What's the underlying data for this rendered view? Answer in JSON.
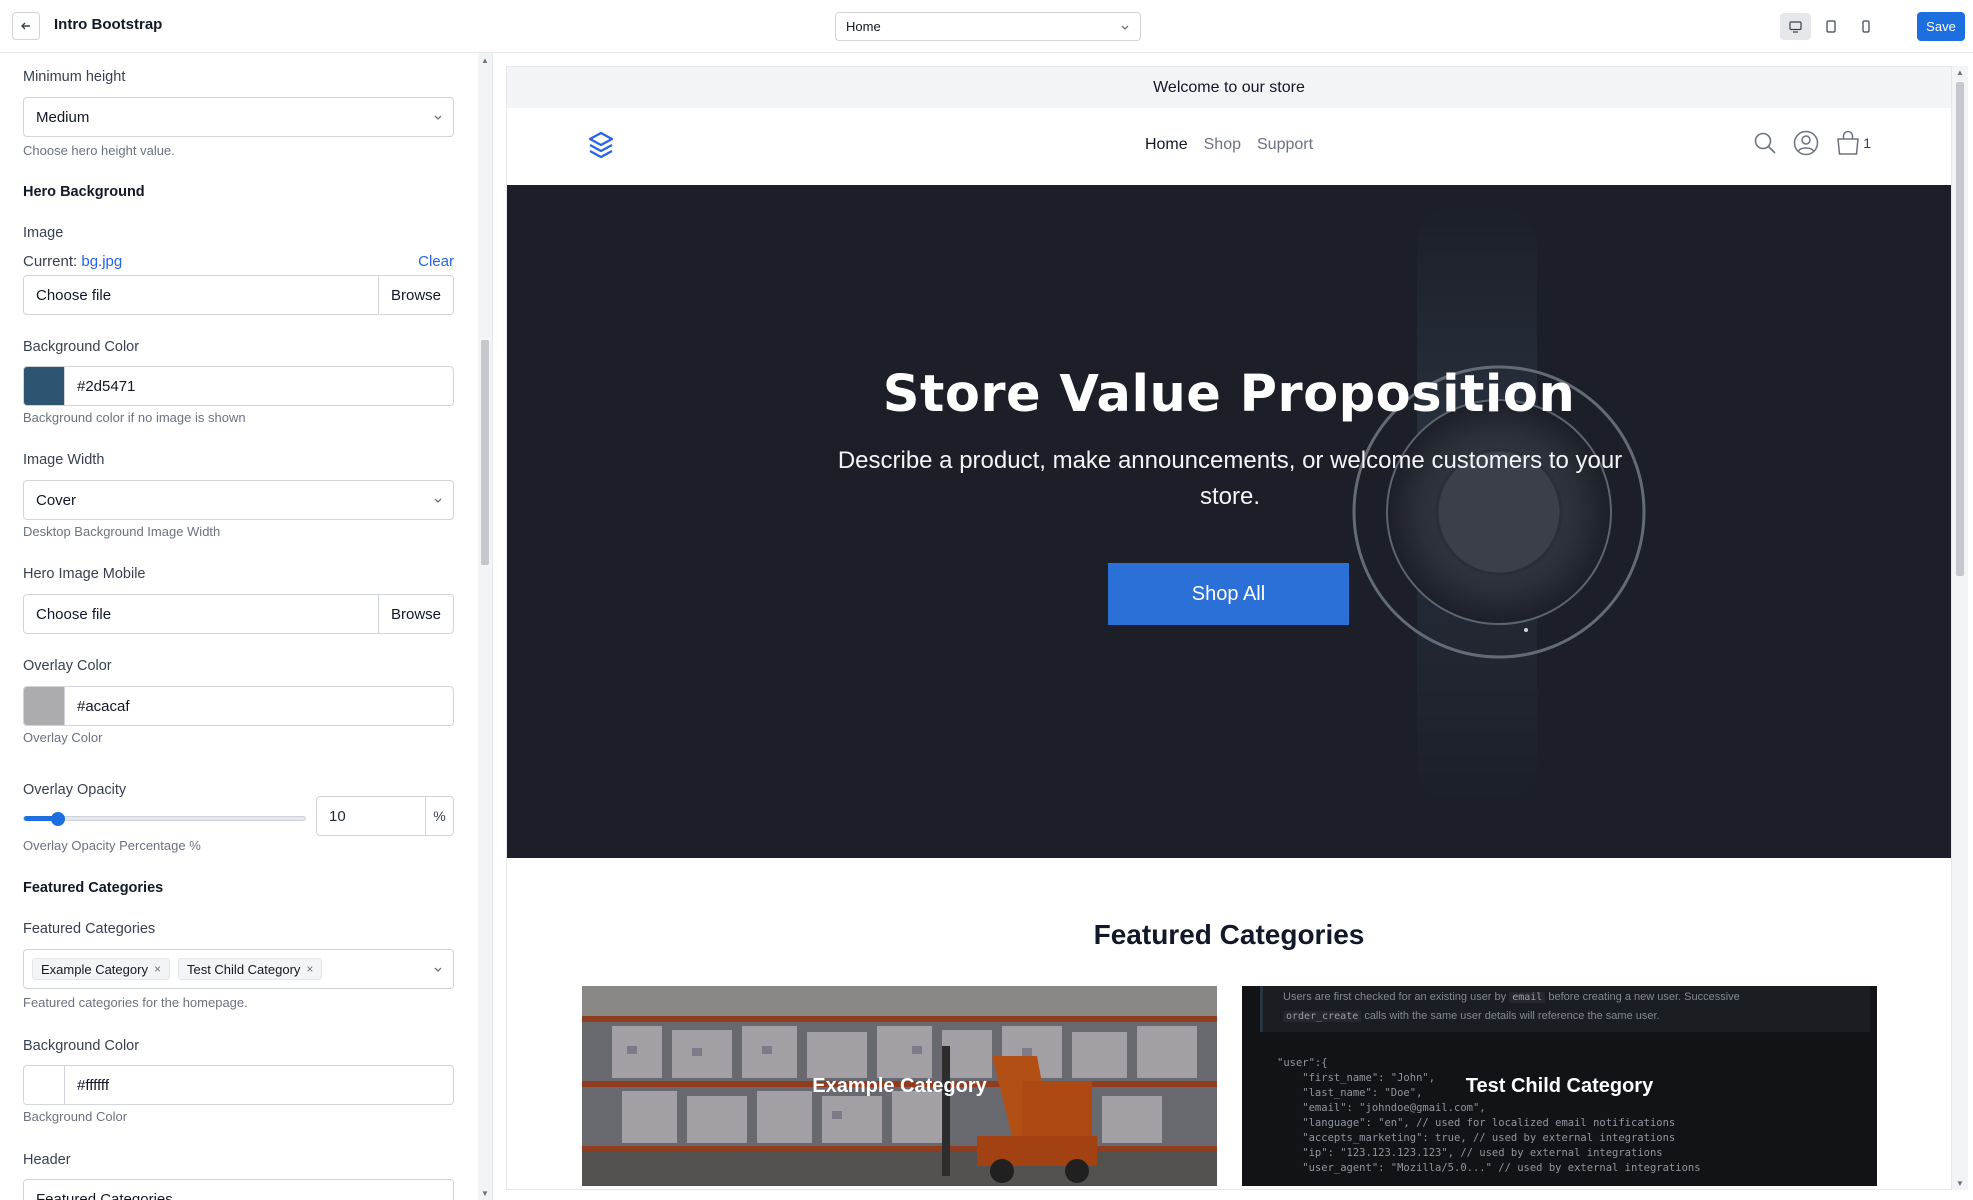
{
  "app": {
    "title": "Intro Bootstrap",
    "page_select": "Home",
    "save_label": "Save"
  },
  "panel": {
    "min_height": {
      "label": "Minimum height",
      "value": "Medium",
      "hint": "Choose hero height value."
    },
    "hero_background": {
      "section": "Hero Background",
      "image_label": "Image",
      "current_label": "Current:",
      "current_file": "bg.jpg",
      "clear_label": "Clear",
      "file_placeholder": "Choose file",
      "browse_label": "Browse"
    },
    "bg_color": {
      "label": "Background Color",
      "value": "#2d5471",
      "hint": "Background color if no image is shown",
      "swatch": "#2d5471"
    },
    "image_width": {
      "label": "Image Width",
      "value": "Cover",
      "hint": "Desktop Background Image Width"
    },
    "hero_mobile": {
      "label": "Hero Image Mobile",
      "file_placeholder": "Choose file",
      "browse_label": "Browse"
    },
    "overlay_color": {
      "label": "Overlay Color",
      "value": "#acacaf",
      "hint": "Overlay Color",
      "swatch": "#acacaf"
    },
    "overlay_opacity": {
      "label": "Overlay Opacity",
      "value": "10",
      "unit": "%",
      "hint": "Overlay Opacity Percentage %",
      "fraction": 0.1
    },
    "featured": {
      "section": "Featured Categories",
      "label": "Featured Categories",
      "tags": [
        "Example Category",
        "Test Child Category"
      ],
      "hint": "Featured categories for the homepage."
    },
    "fc_bg_color": {
      "label": "Background Color",
      "value": "#ffffff",
      "hint": "Background Color",
      "swatch": "#ffffff"
    },
    "header": {
      "label": "Header",
      "value": "Featured Categories"
    }
  },
  "preview": {
    "announcement": "Welcome to our store",
    "nav": [
      "Home",
      "Shop",
      "Support"
    ],
    "cart_count": "1",
    "hero_title": "Store Value Proposition",
    "hero_subtitle": "Describe a product, make announcements, or welcome customers to your store.",
    "hero_cta": "Shop All",
    "featured_title": "Featured Categories",
    "categories": [
      "Example Category",
      "Test Child Category"
    ],
    "code_note_1": "Users are first checked for an existing user by",
    "code_note_email": "email",
    "code_note_2": "before creating a new user. Successive",
    "code_note_3": "order_create",
    "code_note_4": "calls with the same user details will reference the same user.",
    "code_lines": [
      "\"user\":{",
      "    \"first_name\": \"John\",",
      "    \"last_name\": \"Doe\",",
      "    \"email\": \"johndoe@gmail.com\",",
      "    \"language\": \"en\", // used for localized email notifications",
      "    \"accepts_marketing\": true, // used by external integrations",
      "    \"ip\": \"123.123.123.123\", // used by external integrations",
      "    \"user_agent\": \"Mozilla/5.0...\" // used by external integrations"
    ]
  },
  "colors": {
    "accent": "#1d6fe0",
    "hero_bg": "#1c1f27",
    "cta": "#2b70d6"
  }
}
